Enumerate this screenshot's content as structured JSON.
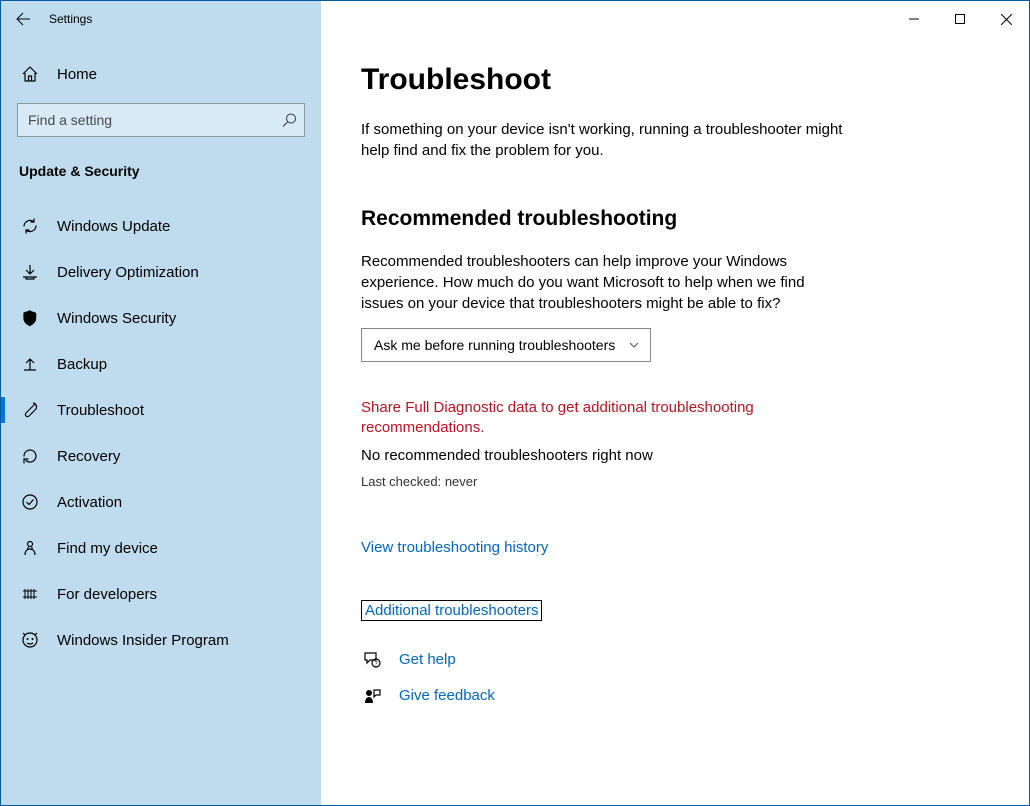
{
  "window": {
    "title": "Settings"
  },
  "sidebar": {
    "home": "Home",
    "search_placeholder": "Find a setting",
    "section": "Update & Security",
    "items": [
      {
        "label": "Windows Update"
      },
      {
        "label": "Delivery Optimization"
      },
      {
        "label": "Windows Security"
      },
      {
        "label": "Backup"
      },
      {
        "label": "Troubleshoot"
      },
      {
        "label": "Recovery"
      },
      {
        "label": "Activation"
      },
      {
        "label": "Find my device"
      },
      {
        "label": "For developers"
      },
      {
        "label": "Windows Insider Program"
      }
    ]
  },
  "main": {
    "title": "Troubleshoot",
    "intro": "If something on your device isn't working, running a troubleshooter might help find and fix the problem for you.",
    "section_heading": "Recommended troubleshooting",
    "rec_desc": "Recommended troubleshooters can help improve your Windows experience. How much do you want Microsoft to help when we find issues on your device that troubleshooters might be able to fix?",
    "dropdown_value": "Ask me before running troubleshooters",
    "warning": "Share Full Diagnostic data to get additional troubleshooting recommendations.",
    "no_rec": "No recommended troubleshooters right now",
    "last_checked": "Last checked: never",
    "history_link": "View troubleshooting history",
    "additional_link": "Additional troubleshooters",
    "get_help": "Get help",
    "give_feedback": "Give feedback"
  }
}
